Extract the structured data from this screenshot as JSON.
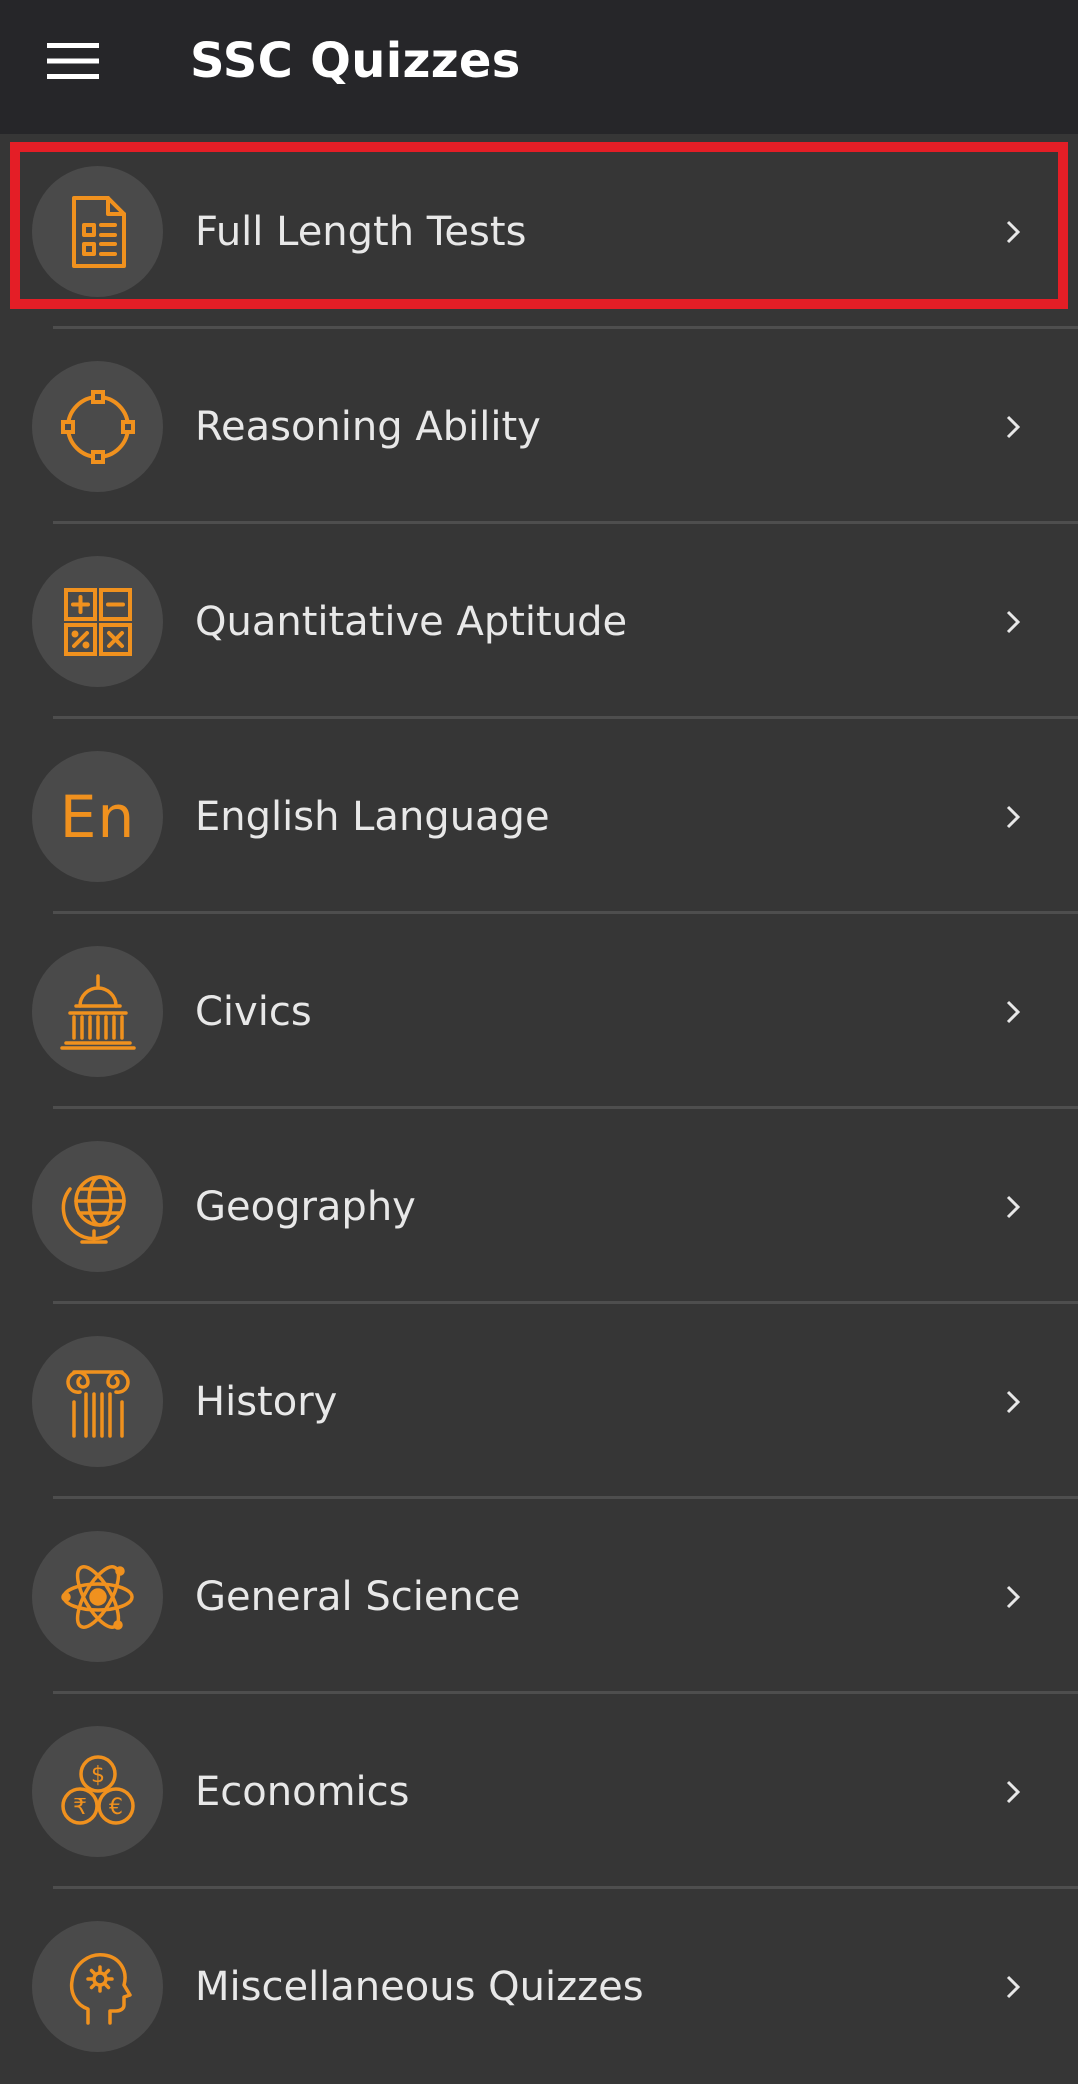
{
  "app": {
    "title": "SSC Quizzes",
    "accent_color": "#f0911e",
    "highlight_color": "#e41e26"
  },
  "header": {
    "menu_icon": "hamburger-menu-icon"
  },
  "categories": [
    {
      "label": "Full Length Tests",
      "icon": "test-document-icon",
      "highlighted": true
    },
    {
      "label": "Reasoning Ability",
      "icon": "reasoning-circle-icon"
    },
    {
      "label": "Quantitative Aptitude",
      "icon": "calculator-icon"
    },
    {
      "label": "English Language",
      "icon": "english-en-icon",
      "icon_text": "En"
    },
    {
      "label": "Civics",
      "icon": "capitol-building-icon"
    },
    {
      "label": "Geography",
      "icon": "globe-icon"
    },
    {
      "label": "History",
      "icon": "ionic-column-icon"
    },
    {
      "label": "General Science",
      "icon": "atom-icon"
    },
    {
      "label": "Economics",
      "icon": "currency-coins-icon"
    },
    {
      "label": "Miscellaneous Quizzes",
      "icon": "brain-gear-icon"
    }
  ]
}
